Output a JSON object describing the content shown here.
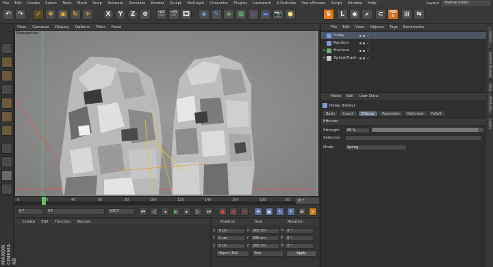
{
  "menubar": {
    "items": [
      "File",
      "Edit",
      "Create",
      "Select",
      "Tools",
      "Mesh",
      "Snap",
      "Animate",
      "Simulate",
      "Render",
      "Sculpt",
      "MoGraph",
      "Character",
      "Plugins",
      "Laubwerk",
      "X-Particles",
      "Vue xStream",
      "Script",
      "Window",
      "Help"
    ],
    "layout_label": "Layout:",
    "layout_value": "Startup (User)"
  },
  "toolbar": {
    "axis_x": "X",
    "axis_y": "Y",
    "axis_z": "Z",
    "psr_label": "PSR",
    "psr_value": "0"
  },
  "viewport": {
    "menu": [
      "View",
      "Cameras",
      "Display",
      "Options",
      "Filter",
      "Panel"
    ],
    "label": "Perspective"
  },
  "timeline": {
    "ticks": [
      "0",
      "20",
      "40",
      "60",
      "80",
      "100",
      "120",
      "140",
      "160",
      "180",
      "20"
    ],
    "playhead_frame": 10,
    "frame_display": "18 F"
  },
  "transport": {
    "start_field": "0 F",
    "current_field": "0 F",
    "end_field": "200 F",
    "max_field": "200 F"
  },
  "material": {
    "menu": [
      "Create",
      "Edit",
      "Function",
      "Texture"
    ]
  },
  "coordinates": {
    "headers": [
      "Position",
      "Size",
      "Rotation"
    ],
    "rows": [
      {
        "axis": "X",
        "pos": "0 cm",
        "size": "200 cm",
        "rot_axis": "H",
        "rot": "0 °"
      },
      {
        "axis": "Y",
        "pos": "0 cm",
        "size": "200 cm",
        "rot_axis": "P",
        "rot": "0 °"
      },
      {
        "axis": "Z",
        "pos": "0 cm",
        "size": "200 cm",
        "rot_axis": "B",
        "rot": "0 °"
      }
    ],
    "mode_object": "Object (Rel)",
    "mode_size": "Size",
    "apply": "Apply"
  },
  "brand": "MAXON CINEMA 4D",
  "object_manager": {
    "menu": [
      "File",
      "Edit",
      "View",
      "Objects",
      "Tags",
      "Bookmarks"
    ],
    "objects": [
      {
        "name": "Delay",
        "color": "#7a9ad8"
      },
      {
        "name": "Random",
        "color": "#7a9ad8"
      },
      {
        "name": "Fracture",
        "color": "#6ab06a"
      },
      {
        "name": "XplodeTrash",
        "color": "#c9c9c9"
      }
    ]
  },
  "attribute_manager": {
    "menu": [
      "Mode",
      "Edit",
      "User Data"
    ],
    "title": "Delay [Delay]",
    "tabs": [
      "Basic",
      "Coord.",
      "Effector",
      "Parameter",
      "Deformer",
      "Falloff"
    ],
    "active_tab": "Effector",
    "section": "Effector",
    "strength_label": "Strength",
    "strength_value": "95 %",
    "strength_fraction": 0.95,
    "selection_label": "Selection",
    "mode_label": "Mode",
    "mode_value": "Spring"
  },
  "right_tabs": [
    "Objects",
    "Content Browser",
    "Structure",
    "Attributes",
    "Layers"
  ]
}
